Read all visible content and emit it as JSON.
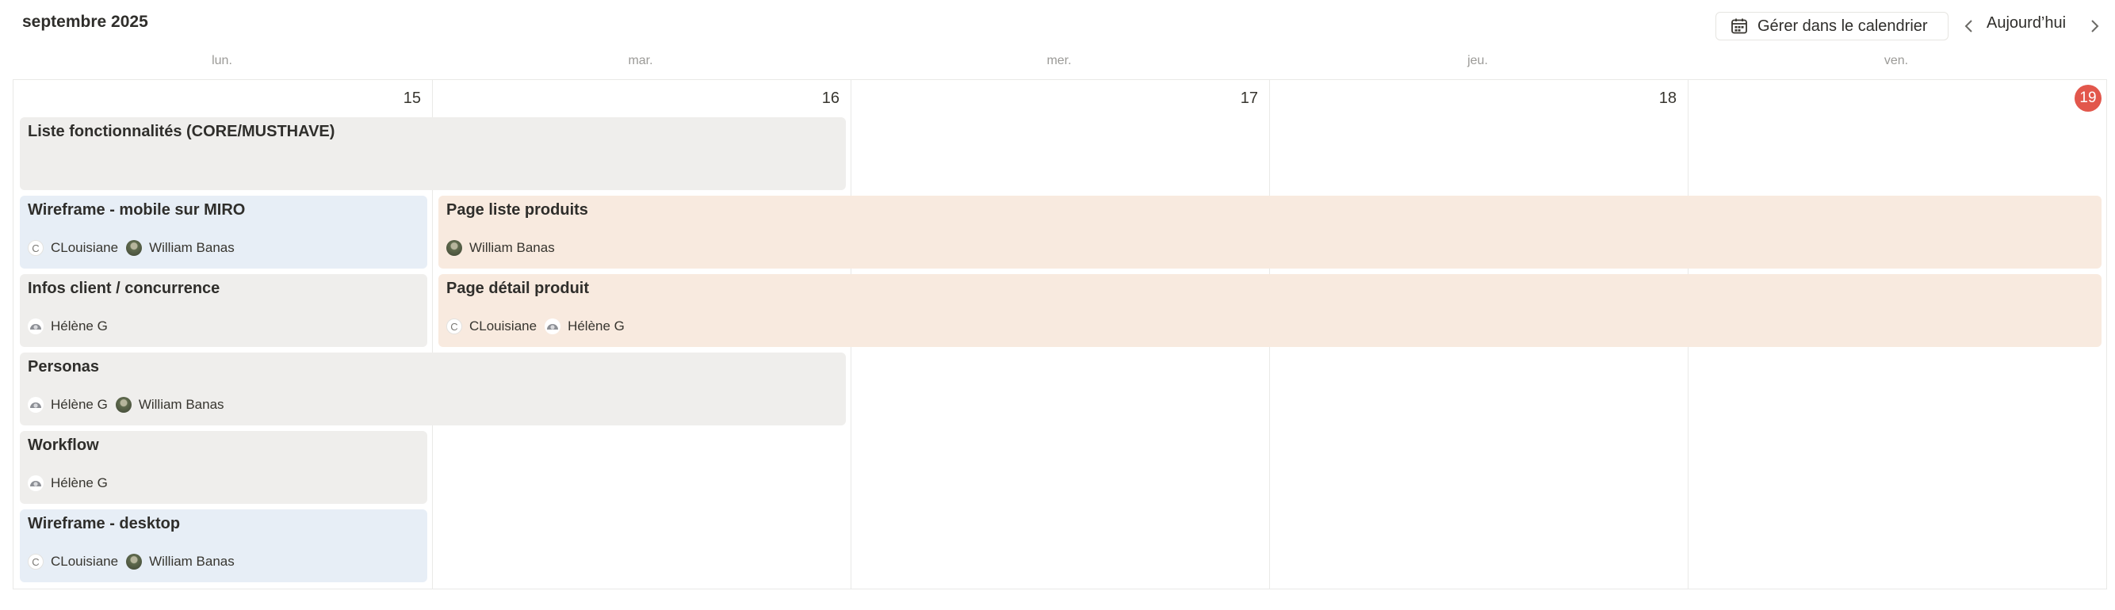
{
  "header": {
    "month": "septembre 2025",
    "manage_label": "Gérer dans le calendrier",
    "today_label": "Aujourd’hui"
  },
  "weekdays": [
    "lun.",
    "mar.",
    "mer.",
    "jeu.",
    "ven."
  ],
  "days": [
    "15",
    "16",
    "17",
    "18",
    "19"
  ],
  "today": "19",
  "events": [
    {
      "title": "Liste fonctionnalités (CORE/MUSTHAVE)"
    },
    {
      "title": "Wireframe - mobile sur MIRO",
      "people": [
        "CLouisiane",
        "William Banas"
      ]
    },
    {
      "title": "Page liste produits",
      "people": [
        "William Banas"
      ]
    },
    {
      "title": "Infos client / concurrence",
      "people": [
        "Hélène G"
      ]
    },
    {
      "title": "Page détail produit",
      "people": [
        "CLouisiane",
        "Hélène G"
      ]
    },
    {
      "title": "Personas",
      "people": [
        "Hélène G",
        "William Banas"
      ]
    },
    {
      "title": "Workflow",
      "people": [
        "Hélène G"
      ]
    },
    {
      "title": "Wireframe - desktop",
      "people": [
        "CLouisiane",
        "William Banas"
      ]
    }
  ],
  "avatar_initial": "C",
  "colors": {
    "grey": "#efeeec",
    "blue": "#e7eef6",
    "peach": "#f8eadf",
    "today": "#e2574c"
  },
  "icons": [
    "calendar-icon",
    "chevron-left-icon",
    "chevron-right-icon"
  ]
}
